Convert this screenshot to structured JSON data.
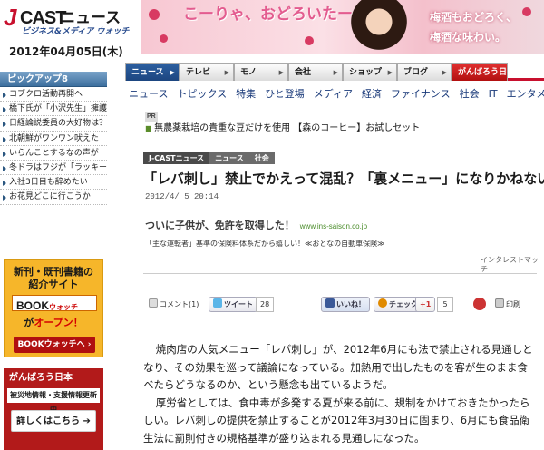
{
  "logo": {
    "j": "J",
    "cast": "CAST",
    "news": "ニュース",
    "sub": "ビジネス&メディア ウォッチ"
  },
  "date": "2012年04月05日(木)",
  "banner": {
    "title": "こーりゃ、おどろいたー",
    "right_line1": "梅酒もおどろく、",
    "right_line2": "梅酒な味わい。"
  },
  "nav": {
    "tabs": [
      "ニュース",
      "テレビ",
      "モノ",
      "会社",
      "ショップ",
      "ブログ"
    ],
    "special": "がんばろう日本"
  },
  "subnav": [
    "ニュース",
    "トピックス",
    "特集",
    "ひと登場",
    "メディア",
    "経済",
    "ファイナンス",
    "社会",
    "IT",
    "エンタメ"
  ],
  "sidebar": {
    "pickup_title": "ピックアップ8",
    "items": [
      "コブクロ活動再開へ",
      "橋下氏が「小沢先生」擁護",
      "日経論説委員の大好物は？",
      "北朝鮮がワンワン吠えた",
      "いらんことするなの声が",
      "冬ドラはフジが「ラッキー」",
      "入社3日目も辞めたい",
      "お花見どこに行こうか"
    ]
  },
  "book_ad": {
    "line1": "新刊・既刊書籍の",
    "line2": "紹介サイト",
    "logo": "BOOK",
    "logo_sub": "ウォッチ",
    "line3a": "が",
    "line3b": "オープン！",
    "button": "BOOKウォッチへ ›"
  },
  "gambarou": {
    "title": "がんばろう日本",
    "sub": "被災地情報・支援情報更新中",
    "button": "詳しくはこちら ➔"
  },
  "pr": {
    "badge": "PR",
    "text": "無農薬栽培の貴重な豆だけを使用 【森のコーヒー】お試しセット"
  },
  "breadcrumb": [
    "J-CASTニュース",
    "ニュース",
    "社会"
  ],
  "article": {
    "headline": "「レバ刺し」禁止でかえって混乱？「裏メニュー」になりかねない",
    "timestamp": "2012/4/ 5 20:14",
    "ad_title": "ついに子供が、免許を取得した！",
    "ad_url": "www.ins-saison.co.jp",
    "ad_desc": "「主な運転者」基準の保険料体系だから嬉しい！≪おとなの自動車保険≫",
    "ad_credit": "インタレストマッチ",
    "paragraphs": [
      "焼肉店の人気メニュー「レバ刺し」が、2012年6月にも法で禁止される見通しとなり、その効果を巡って議論になっている。加熱用で出したものを客が生のまま食べたらどうなるのか、という懸念も出ているようだ。",
      "厚労省としては、食中毒が多発する夏が来る前に、規制をかけておきたかったらしい。レバ刺しの提供を禁止することが2012年3月30日に固まり、6月にも食品衛生法に罰則付きの規格基準が盛り込まれる見通しになった。"
    ]
  },
  "social": {
    "comment": "コメント(1)",
    "tweet": "ツイート",
    "tweet_count": "28",
    "like": "いいね！",
    "check": "チェック",
    "gplus": "+1",
    "gplus_count": "5",
    "print": "印刷"
  }
}
